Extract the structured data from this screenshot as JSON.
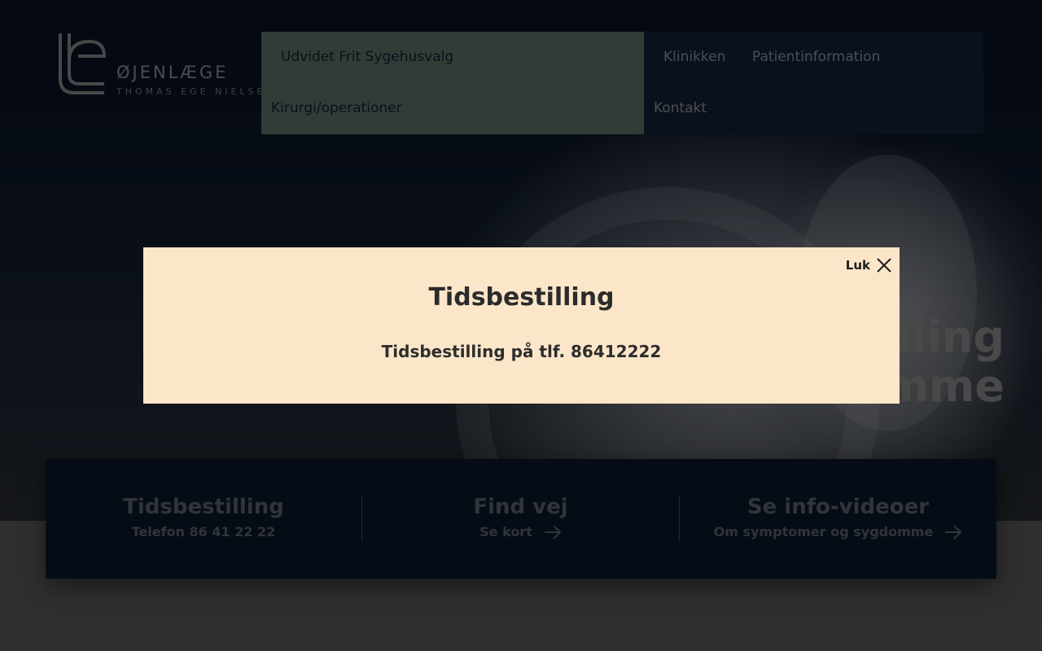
{
  "logo": {
    "name": "ØJENLÆGE",
    "subtitle": "THOMAS EGE NIELSEN"
  },
  "nav": {
    "items": [
      {
        "label": "Udvidet Frit Sygehusvalg"
      },
      {
        "label": "Klinikken"
      },
      {
        "label": "Patientinformation"
      },
      {
        "label": "Kirurgi/operationer"
      },
      {
        "label": "Kontakt"
      }
    ]
  },
  "hero": {
    "title_line1": "dling",
    "title_line2": "omme"
  },
  "modal": {
    "close_label": "Luk",
    "title": "Tidsbestilling",
    "text": "Tidsbestilling på tlf. 86412222"
  },
  "infobar": {
    "columns": [
      {
        "title": "Tidsbestilling",
        "sub": "Telefon 86 41 22 22"
      },
      {
        "title": "Find vej",
        "sub": "Se kort",
        "icon": "arrow-right-icon"
      },
      {
        "title": "Se info-videoer",
        "sub": "Om symptomer og sygdomme",
        "icon": "arrow-right-icon"
      }
    ]
  },
  "colors": {
    "nav_background": "#0b1524",
    "nav_highlight": "#3e4a44",
    "modal_background": "#fce6c9",
    "infobar_background": "#080f1a"
  }
}
